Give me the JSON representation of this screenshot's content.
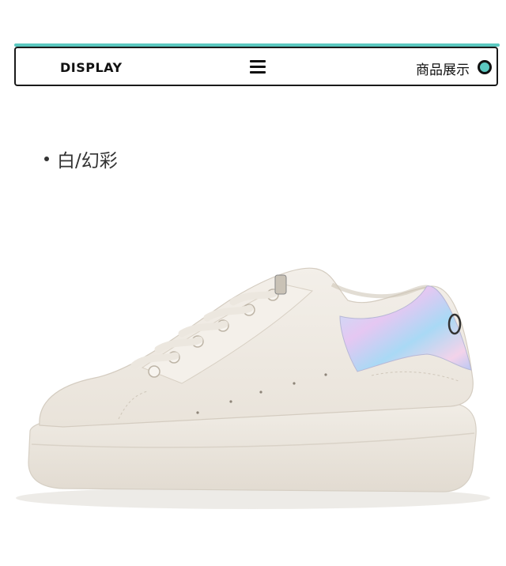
{
  "header": {
    "brand": "DISPLAY",
    "title": "商品展示",
    "menu_icon": "hamburger-menu-icon",
    "accent_color": "#5bc8c0"
  },
  "product": {
    "color_label": "白/幻彩",
    "image": "white-sneaker-iridescent-heel"
  }
}
